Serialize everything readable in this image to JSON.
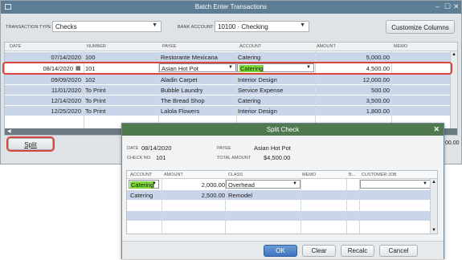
{
  "window": {
    "title": "Batch Enter Transactions",
    "controls": [
      "–",
      "☐",
      "✕"
    ]
  },
  "toolbar": {
    "transaction_type_label": "TRANSACTION TYPE",
    "transaction_type_value": "Checks",
    "bank_account_label": "BANK ACCOUNT",
    "bank_account_value": "10100 · Checking",
    "customize_columns": "Customize Columns"
  },
  "grid": {
    "columns": [
      "DATE",
      "NUMBER",
      "PAYEE",
      "ACCOUNT",
      "AMOUNT",
      "MEMO"
    ],
    "rows": [
      {
        "date": "07/14/2020",
        "number": "100",
        "payee": "Restorante Mexicana",
        "account": "Catering",
        "amount": "5,000.00"
      },
      {
        "date": "08/14/2020",
        "number": "101",
        "payee": "Asian Hot Pot",
        "account": "Catering",
        "amount": "4,500.00"
      },
      {
        "date": "09/09/2020",
        "number": "102",
        "payee": "Aladin Carpet",
        "account": "Interior Design",
        "amount": "12,000.00"
      },
      {
        "date": "11/01/2020",
        "number": "To Print",
        "payee": "Bubble Laundry",
        "account": "Service Expense",
        "amount": "500.00"
      },
      {
        "date": "12/14/2020",
        "number": "To Print",
        "payee": "The Bread Shop",
        "account": "Catering",
        "amount": "3,500.00"
      },
      {
        "date": "12/25/2020",
        "number": "To Print",
        "payee": "Lalola Flowers",
        "account": "Interior Design",
        "amount": "1,800.00"
      }
    ]
  },
  "bottom": {
    "split_label": "Split",
    "total_fragment": "00.00"
  },
  "dialog": {
    "title": "Split Check",
    "date_label": "DATE",
    "date_value": "08/14/2020",
    "checkno_label": "CHECK NO.",
    "checkno_value": "101",
    "payee_label": "PAYEE",
    "payee_value": "Asian Hot Pot",
    "total_label": "TOTAL AMOUNT",
    "total_value": "$4,500.00",
    "columns": [
      "ACCOUNT",
      "AMOUNT",
      "CLASS",
      "MEMO",
      "B...",
      "CUSTOMER:JOB"
    ],
    "rows": [
      {
        "account": "Catering",
        "amount": "2,000.00",
        "class": "Overhead"
      },
      {
        "account": "Catering",
        "amount": "2,500.00",
        "class": "Remodel"
      }
    ],
    "buttons": {
      "ok": "OK",
      "clear": "Clear",
      "recalc": "Recalc",
      "cancel": "Cancel"
    }
  }
}
